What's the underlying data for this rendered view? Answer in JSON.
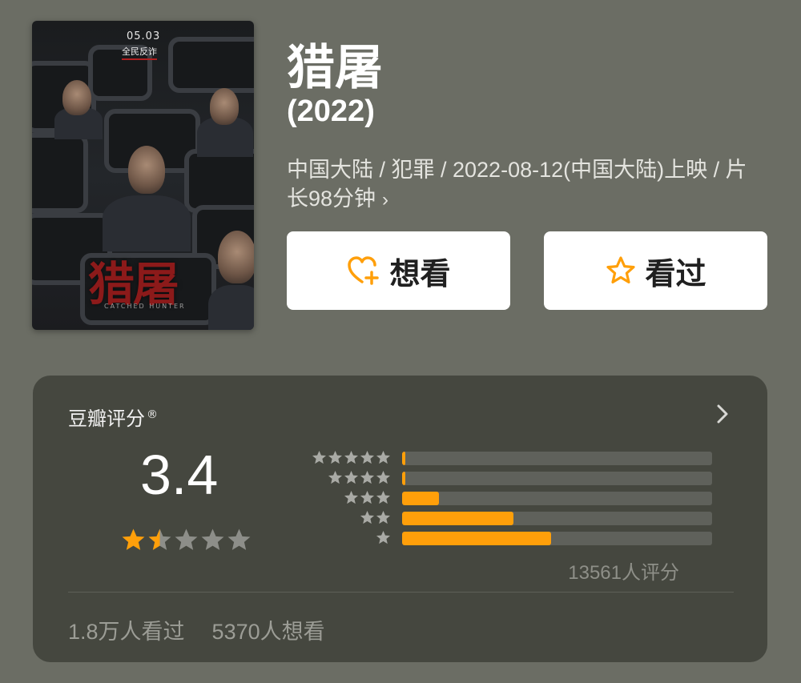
{
  "poster": {
    "date": "05.03",
    "slogan": "全民反诈",
    "title_art": "猎屠",
    "subtitle_art": "CATCHED HUNTER"
  },
  "movie": {
    "title": "猎屠",
    "year": "(2022)",
    "meta_line": "中国大陆 / 犯罪 / 2022-08-12(中国大陆)上映 / 片长98分钟"
  },
  "actions": {
    "want_label": "想看",
    "seen_label": "看过",
    "want_icon": "heart-plus-icon",
    "seen_icon": "star-outline-icon",
    "icon_color": "#ff9f0a"
  },
  "rating": {
    "source_label": "豆瓣评分",
    "registered_mark": "®",
    "score": "3.4",
    "stars_value": 1.5,
    "stars_max": 5,
    "distribution_percent": [
      1,
      1,
      12,
      36,
      48
    ],
    "distribution_labels": [
      "5星",
      "4星",
      "3星",
      "2星",
      "1星"
    ],
    "count_text": "13561人评分",
    "accent_color": "#ff9f0a"
  },
  "stats": {
    "seen_text": "1.8万人看过",
    "want_text": "5370人想看"
  }
}
